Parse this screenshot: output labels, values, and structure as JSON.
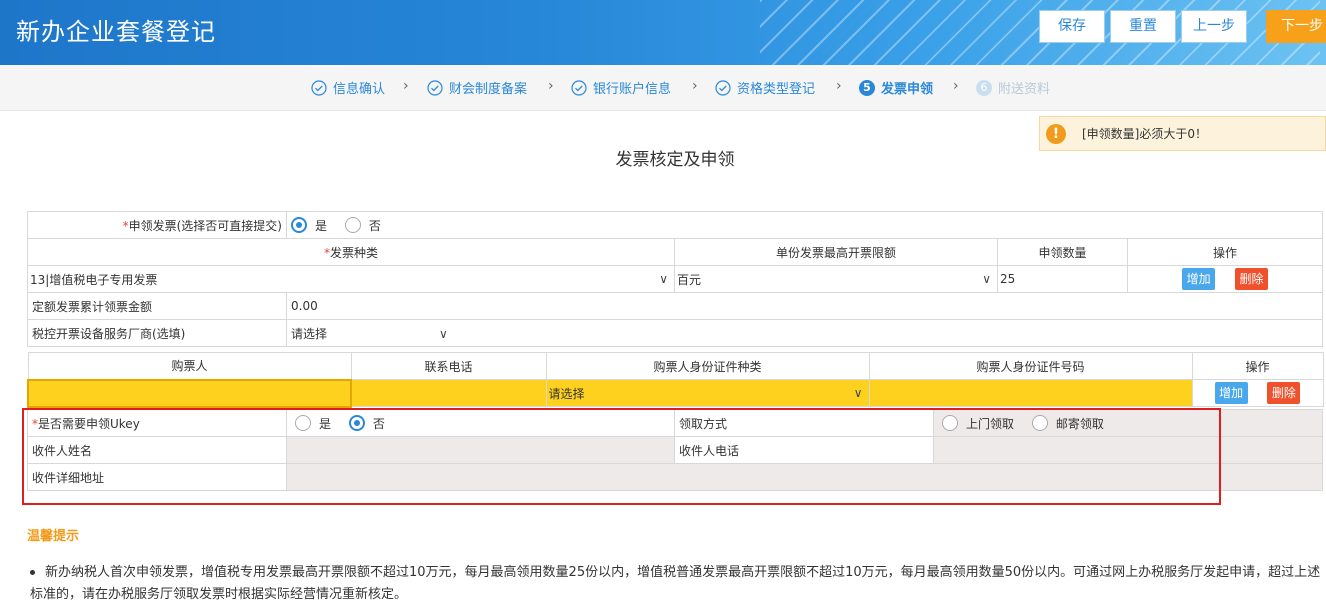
{
  "header": {
    "title": "新办企业套餐登记",
    "buttons": {
      "save": "保存",
      "reset": "重置",
      "prev": "上一步",
      "next": "下一步"
    }
  },
  "steps": [
    {
      "label": "信息确认",
      "status": "done"
    },
    {
      "label": "财会制度备案",
      "status": "done"
    },
    {
      "label": "银行账户信息",
      "status": "done"
    },
    {
      "label": "资格类型登记",
      "status": "done"
    },
    {
      "label": "发票申领",
      "status": "current",
      "number": "5"
    },
    {
      "label": "附送资料",
      "status": "todo",
      "number": "6"
    }
  ],
  "alert": {
    "text": "[申领数量]必须大于0！",
    "icon": "!"
  },
  "page_title": "发票核定及申领",
  "form": {
    "apply_label": "申领发票(选择否可直接提交)",
    "apply_options": {
      "yes": "是",
      "no": "否"
    },
    "invoice_headers": {
      "type": "发票种类",
      "max_limit": "单份发票最高开票限额",
      "quantity": "申领数量",
      "ops": "操作"
    },
    "invoice_row": {
      "type": "13|增值税电子专用发票",
      "limit": "百元",
      "quantity": "25",
      "add": "增加",
      "delete": "删除"
    },
    "fixed_amount_label": "定额发票累计领票金额",
    "fixed_amount_value": "0.00",
    "vendor_label": "税控开票设备服务厂商(选填)",
    "vendor_value": "请选择",
    "buyer_headers": {
      "buyer": "购票人",
      "phone": "联系电话",
      "id_type": "购票人身份证件种类",
      "id_no": "购票人身份证件号码",
      "ops": "操作"
    },
    "buyer_row": {
      "buyer": "",
      "phone": "",
      "id_type": "请选择",
      "id_no": "",
      "add": "增加",
      "delete": "删除"
    },
    "ukey_label": "是否需要申领Ukey",
    "ukey_options": {
      "yes": "是",
      "no": "否"
    },
    "pickup_label": "领取方式",
    "pickup_options": {
      "onsite": "上门领取",
      "mail": "邮寄领取"
    },
    "recipient_name_label": "收件人姓名",
    "recipient_phone_label": "收件人电话",
    "address_label": "收件详细地址"
  },
  "tips": {
    "title": "温馨提示",
    "line1": "新办纳税人首次申领发票，增值税专用发票最高开票限额不超过10万元，每月最高领用数量25份以内，增值税普通发票最高开票限额不超过10万元，每月最高领用数量50份以内。可通过网上办税服务厅发起申请，超过上述标准的，请在办税服务厅领取发票时根据实际经营情况重新核定。"
  },
  "colors": {
    "primary": "#2b88d8",
    "accent": "#f7a11a",
    "highlight": "#fdd11e",
    "danger": "#f0512c",
    "alert_box": "#e11e1e"
  }
}
